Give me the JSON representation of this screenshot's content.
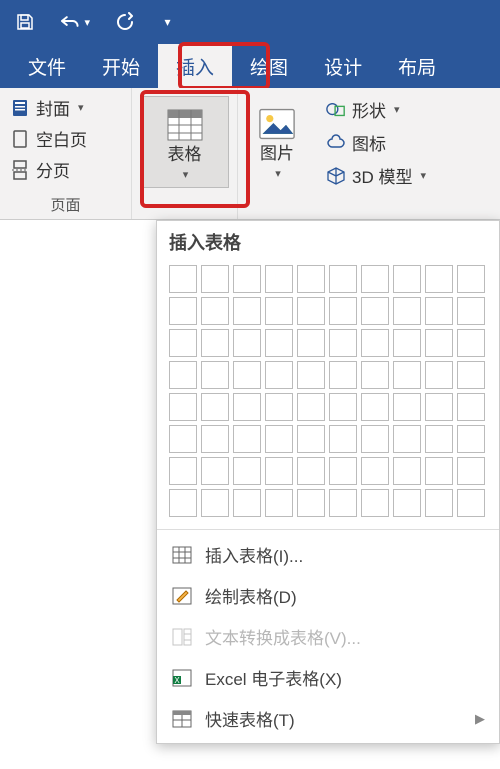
{
  "tabs": {
    "file": "文件",
    "home": "开始",
    "insert": "插入",
    "draw": "绘图",
    "design": "设计",
    "layout": "布局"
  },
  "ribbon": {
    "pages_group_label": "页面",
    "cover_page": "封面",
    "blank_page": "空白页",
    "page_break": "分页",
    "table_label": "表格",
    "picture_label": "图片",
    "shapes_label": "形状",
    "icons_label": "图标",
    "model3d_label": "3D 模型"
  },
  "table_dropdown": {
    "title": "插入表格",
    "insert_table": "插入表格(I)...",
    "draw_table": "绘制表格(D)",
    "text_to_table": "文本转换成表格(V)...",
    "excel_spreadsheet": "Excel 电子表格(X)",
    "quick_tables": "快速表格(T)"
  }
}
